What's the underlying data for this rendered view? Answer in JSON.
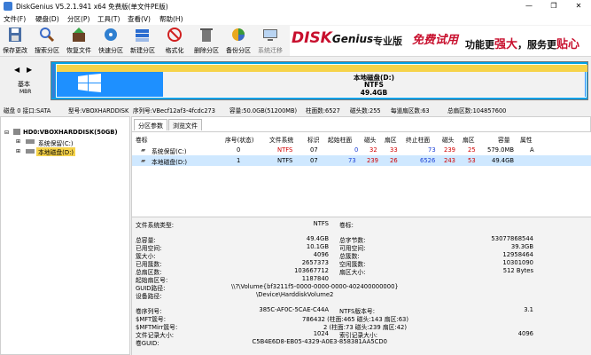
{
  "window": {
    "title": "DiskGenius V5.2.1.941 x64 免费版(单文件PE版)",
    "min": "—",
    "max": "❐",
    "close": "✕"
  },
  "menu": [
    "文件(F)",
    "硬盘(D)",
    "分区(P)",
    "工具(T)",
    "查看(V)",
    "帮助(H)"
  ],
  "toolbar": [
    {
      "label": "保存更改",
      "icon": "save-icon"
    },
    {
      "label": "搜索分区",
      "icon": "search-partition-icon"
    },
    {
      "label": "恢复文件",
      "icon": "restore-file-icon"
    },
    {
      "label": "快速分区",
      "icon": "quick-partition-icon"
    },
    {
      "label": "新建分区",
      "icon": "new-partition-icon"
    },
    {
      "label": "格式化",
      "icon": "format-icon"
    },
    {
      "label": "删除分区",
      "icon": "delete-partition-icon"
    },
    {
      "label": "备份分区",
      "icon": "backup-partition-icon"
    },
    {
      "label": "系统迁移",
      "icon": "system-migrate-icon"
    }
  ],
  "banner": {
    "logo_main": "DISK",
    "logo_sub": "Genius",
    "edition": "专业版",
    "slogan": "免费试用",
    "tagline_pre": "功能更",
    "tagline_hl": "强大",
    "tagline_post": "，服务更",
    "tagline_hl2": "贴心"
  },
  "nav": {
    "back": "◀",
    "forward": "▶",
    "label_1": "基本",
    "label_2": "MBR"
  },
  "diskbar": {
    "name": "本地磁盘(D:)",
    "fs": "NTFS",
    "size": "49.4GB"
  },
  "diskinfo": {
    "disk": "磁盘 0 接口:SATA",
    "model": "型号:VBOXHARDDISK",
    "serial": "序列号:VBecf12af3-4fcdc273",
    "capacity": "容量:50.0GB(51200MB)",
    "cylinders": "柱面数:6527",
    "heads": "磁头数:255",
    "sectors_per_track": "每道扇区数:63",
    "total_sectors": "总扇区数:104857600"
  },
  "tree": {
    "disk": "HD0:VBOXHARDDISK(50GB)",
    "partitions": [
      "系统保留(C:)",
      "本地磁盘(D:)"
    ]
  },
  "tabs": [
    "分区参数",
    "浏览文件"
  ],
  "table": {
    "headers": [
      "卷标",
      "序号(状态)",
      "文件系统",
      "标识",
      "起始柱面",
      "磁头",
      "扇区",
      "终止柱面",
      "磁头",
      "扇区",
      "容量",
      "属性"
    ],
    "rows": [
      {
        "name": "系统保留(C:)",
        "seq": "0",
        "fs": "NTFS",
        "id": "07",
        "start_cyl": "0",
        "start_head": "32",
        "start_sec": "33",
        "end_cyl": "73",
        "end_head": "239",
        "end_sec": "25",
        "size": "579.0MB",
        "attr": "A"
      },
      {
        "name": "本地磁盘(D:)",
        "seq": "1",
        "fs": "NTFS",
        "id": "07",
        "start_cyl": "73",
        "start_head": "239",
        "start_sec": "26",
        "end_cyl": "6526",
        "end_head": "243",
        "end_sec": "53",
        "size": "49.4GB",
        "attr": ""
      }
    ]
  },
  "details": {
    "fs_type_label": "文件系统类型:",
    "fs_type": "NTFS",
    "volume_label": "卷标:",
    "left": [
      {
        "k": "总容量:",
        "v": "49.4GB"
      },
      {
        "k": "已用空间:",
        "v": "10.1GB"
      },
      {
        "k": "簇大小:",
        "v": "4096"
      },
      {
        "k": "已用簇数:",
        "v": "2657373"
      },
      {
        "k": "总扇区数:",
        "v": "103667712"
      },
      {
        "k": "起始扇区号:",
        "v": "1187840"
      }
    ],
    "right": [
      {
        "k": "总字节数:",
        "v": "53077868544"
      },
      {
        "k": "可用空间:",
        "v": "39.3GB"
      },
      {
        "k": "总簇数:",
        "v": "12958464"
      },
      {
        "k": "空闲簇数:",
        "v": "10301090"
      },
      {
        "k": "扇区大小:",
        "v": "512 Bytes"
      }
    ],
    "guid_path_label": "GUID路径:",
    "guid_path": "\\\\?\\Volume{bf3211f5-0000-0000-0000-402400000000}",
    "device_path_label": "设备路径:",
    "device_path": "\\Device\\HarddiskVolume2",
    "serial_label": "卷序列号:",
    "serial": "385C-AF0C-5CAE-C44A",
    "ntfs_ver_label": "NTFS版本号:",
    "ntfs_ver": "3.1",
    "mft_label": "$MFT簇号:",
    "mft": "786432 (柱面:465 磁头:143 扇区:63)",
    "mftmirr_label": "$MFTMirr簇号:",
    "mftmirr": "2 (柱面:73 磁头:239 扇区:42)",
    "record_size_label": "文件记录大小:",
    "record_size": "1024",
    "index_size_label": "索引记录大小:",
    "index_size": "4096",
    "guid_label": "卷GUID:",
    "guid": "C5B4E6D8-EB05-4329-A0E3-858381AA5CD0"
  }
}
